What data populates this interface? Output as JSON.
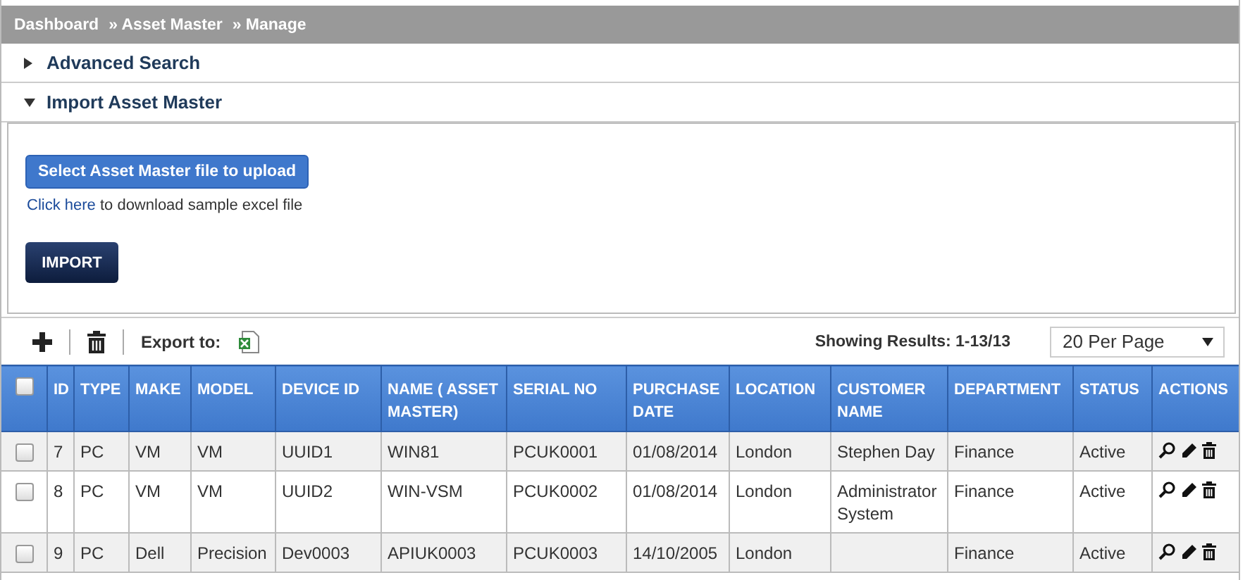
{
  "breadcrumb": [
    "Dashboard",
    "» Asset Master",
    "» Manage"
  ],
  "sections": [
    {
      "title": "Advanced Search",
      "expanded": false
    },
    {
      "title": "Import Asset Master",
      "expanded": true
    }
  ],
  "import_panel": {
    "upload_button": "Select Asset Master file to upload",
    "link": "Click here",
    "link_text": "to download sample excel file",
    "import_button": "IMPORT"
  },
  "toolbar": {
    "export_label": "Export to:",
    "results": "Showing Results: 1-13/13",
    "per_page": "20 Per Page"
  },
  "table": {
    "select_all_checked": false,
    "columns": [
      "ID",
      "TYPE",
      "MAKE",
      "MODEL",
      "DEVICE ID",
      "NAME ( ASSET MASTER)",
      "SERIAL NO",
      "PURCHASE DATE",
      "LOCATION",
      "CUSTOMER NAME",
      "DEPARTMENT",
      "STATUS",
      "ACTIONS"
    ],
    "rows": [
      {
        "checked": false,
        "cells": [
          "7",
          "PC",
          "VM",
          "VM",
          "UUID1",
          "WIN81",
          "PCUK0001",
          "01/08/2014",
          "London",
          "Stephen Day",
          "Finance",
          "Active"
        ]
      },
      {
        "checked": false,
        "cells": [
          "8",
          "PC",
          "VM",
          "VM",
          "UUID2",
          "WIN-VSM",
          "PCUK0002",
          "01/08/2014",
          "London",
          "Administrator System",
          "Finance",
          "Active"
        ]
      },
      {
        "checked": false,
        "cells": [
          "9",
          "PC",
          "Dell",
          "Precision",
          "Dev0003",
          "APIUK0003",
          "PCUK0003",
          "14/10/2005",
          "London",
          "",
          "Finance",
          "Active"
        ]
      }
    ]
  }
}
